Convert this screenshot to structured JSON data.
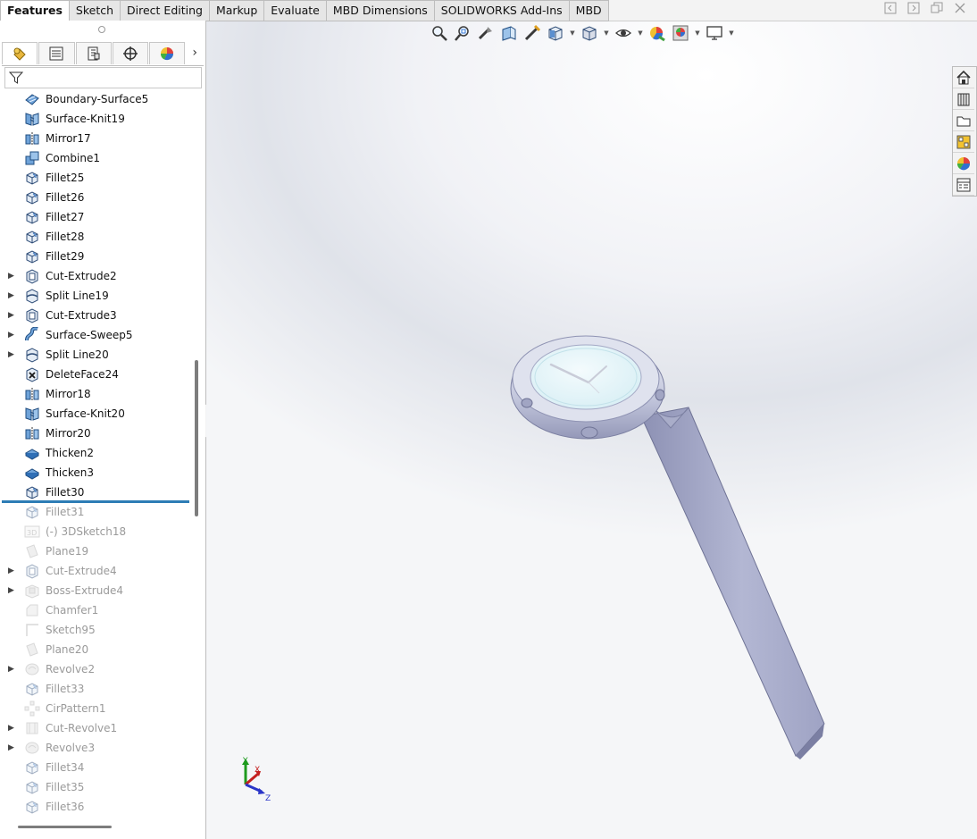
{
  "command_tabs": [
    {
      "label": "Features",
      "active": true
    },
    {
      "label": "Sketch",
      "active": false
    },
    {
      "label": "Direct Editing",
      "active": false
    },
    {
      "label": "Markup",
      "active": false
    },
    {
      "label": "Evaluate",
      "active": false
    },
    {
      "label": "MBD Dimensions",
      "active": false
    },
    {
      "label": "SOLIDWORKS Add-Ins",
      "active": false
    },
    {
      "label": "MBD",
      "active": false
    }
  ],
  "manager_tabs": [
    "featuremanager-icon",
    "propertymanager-icon",
    "configurationmanager-icon",
    "dimxpertmanager-icon",
    "displaymanager-icon"
  ],
  "feature_tree": [
    {
      "label": "Boundary-Surface5",
      "icon": "boundary-surface-icon",
      "expandable": false,
      "suppressed": false
    },
    {
      "label": "Surface-Knit19",
      "icon": "surface-knit-icon",
      "expandable": false,
      "suppressed": false
    },
    {
      "label": "Mirror17",
      "icon": "mirror-icon",
      "expandable": false,
      "suppressed": false
    },
    {
      "label": "Combine1",
      "icon": "combine-icon",
      "expandable": false,
      "suppressed": false
    },
    {
      "label": "Fillet25",
      "icon": "fillet-icon",
      "expandable": false,
      "suppressed": false
    },
    {
      "label": "Fillet26",
      "icon": "fillet-icon",
      "expandable": false,
      "suppressed": false
    },
    {
      "label": "Fillet27",
      "icon": "fillet-icon",
      "expandable": false,
      "suppressed": false
    },
    {
      "label": "Fillet28",
      "icon": "fillet-icon",
      "expandable": false,
      "suppressed": false
    },
    {
      "label": "Fillet29",
      "icon": "fillet-icon",
      "expandable": false,
      "suppressed": false
    },
    {
      "label": "Cut-Extrude2",
      "icon": "cut-extrude-icon",
      "expandable": true,
      "suppressed": false
    },
    {
      "label": "Split Line19",
      "icon": "split-line-icon",
      "expandable": true,
      "suppressed": false
    },
    {
      "label": "Cut-Extrude3",
      "icon": "cut-extrude-icon",
      "expandable": true,
      "suppressed": false
    },
    {
      "label": "Surface-Sweep5",
      "icon": "surface-sweep-icon",
      "expandable": true,
      "suppressed": false
    },
    {
      "label": "Split Line20",
      "icon": "split-line-icon",
      "expandable": true,
      "suppressed": false
    },
    {
      "label": "DeleteFace24",
      "icon": "delete-face-icon",
      "expandable": false,
      "suppressed": false
    },
    {
      "label": "Mirror18",
      "icon": "mirror-icon",
      "expandable": false,
      "suppressed": false
    },
    {
      "label": "Surface-Knit20",
      "icon": "surface-knit-icon",
      "expandable": false,
      "suppressed": false
    },
    {
      "label": "Mirror20",
      "icon": "mirror-icon",
      "expandable": false,
      "suppressed": false
    },
    {
      "label": "Thicken2",
      "icon": "thicken-icon",
      "expandable": false,
      "suppressed": false
    },
    {
      "label": "Thicken3",
      "icon": "thicken-icon",
      "expandable": false,
      "suppressed": false
    },
    {
      "label": "Fillet30",
      "icon": "fillet-icon",
      "expandable": false,
      "suppressed": false
    },
    {
      "label": "Fillet31",
      "icon": "fillet-icon",
      "expandable": false,
      "suppressed": true
    },
    {
      "label": "(-) 3DSketch18",
      "icon": "3d-sketch-icon",
      "expandable": false,
      "suppressed": true
    },
    {
      "label": "Plane19",
      "icon": "plane-icon",
      "expandable": false,
      "suppressed": true
    },
    {
      "label": "Cut-Extrude4",
      "icon": "cut-extrude-icon",
      "expandable": true,
      "suppressed": true
    },
    {
      "label": "Boss-Extrude4",
      "icon": "boss-extrude-icon",
      "expandable": true,
      "suppressed": true
    },
    {
      "label": "Chamfer1",
      "icon": "chamfer-icon",
      "expandable": false,
      "suppressed": true
    },
    {
      "label": "Sketch95",
      "icon": "sketch-icon",
      "expandable": false,
      "suppressed": true
    },
    {
      "label": "Plane20",
      "icon": "plane-icon",
      "expandable": false,
      "suppressed": true
    },
    {
      "label": "Revolve2",
      "icon": "revolve-icon",
      "expandable": true,
      "suppressed": true
    },
    {
      "label": "Fillet33",
      "icon": "fillet-icon",
      "expandable": false,
      "suppressed": true
    },
    {
      "label": "CirPattern1",
      "icon": "circular-pattern-icon",
      "expandable": false,
      "suppressed": true
    },
    {
      "label": "Cut-Revolve1",
      "icon": "cut-revolve-icon",
      "expandable": true,
      "suppressed": true
    },
    {
      "label": "Revolve3",
      "icon": "revolve-icon",
      "expandable": true,
      "suppressed": true
    },
    {
      "label": "Fillet34",
      "icon": "fillet-icon",
      "expandable": false,
      "suppressed": true
    },
    {
      "label": "Fillet35",
      "icon": "fillet-icon",
      "expandable": false,
      "suppressed": true
    },
    {
      "label": "Fillet36",
      "icon": "fillet-icon",
      "expandable": false,
      "suppressed": true
    }
  ],
  "rollback_after": "Fillet30",
  "heads_up_toolbar": [
    {
      "icon": "zoom-to-fit-icon",
      "dropdown": false
    },
    {
      "icon": "zoom-to-area-icon",
      "dropdown": false
    },
    {
      "icon": "previous-view-icon",
      "dropdown": false
    },
    {
      "icon": "section-view-icon",
      "dropdown": false
    },
    {
      "icon": "dynamic-annotation-icon",
      "dropdown": false
    },
    {
      "icon": "view-orientation-icon",
      "dropdown": true
    },
    {
      "icon": "display-style-icon",
      "dropdown": true
    },
    {
      "icon": "hide-show-items-icon",
      "dropdown": true
    },
    {
      "icon": "edit-appearance-icon",
      "dropdown": false
    },
    {
      "icon": "apply-scene-icon",
      "dropdown": true
    },
    {
      "icon": "view-settings-icon",
      "dropdown": true
    }
  ],
  "task_pane": [
    "solidworks-resources-icon",
    "design-library-icon",
    "file-explorer-icon",
    "view-palette-icon",
    "appearances-icon",
    "custom-properties-icon"
  ],
  "triad_axes": [
    "Y",
    "X",
    "Z"
  ],
  "colors": {
    "rollback_bar": "#2d7db5",
    "model_band": "#a7abc9",
    "dial_face": "#e6f7fb"
  }
}
